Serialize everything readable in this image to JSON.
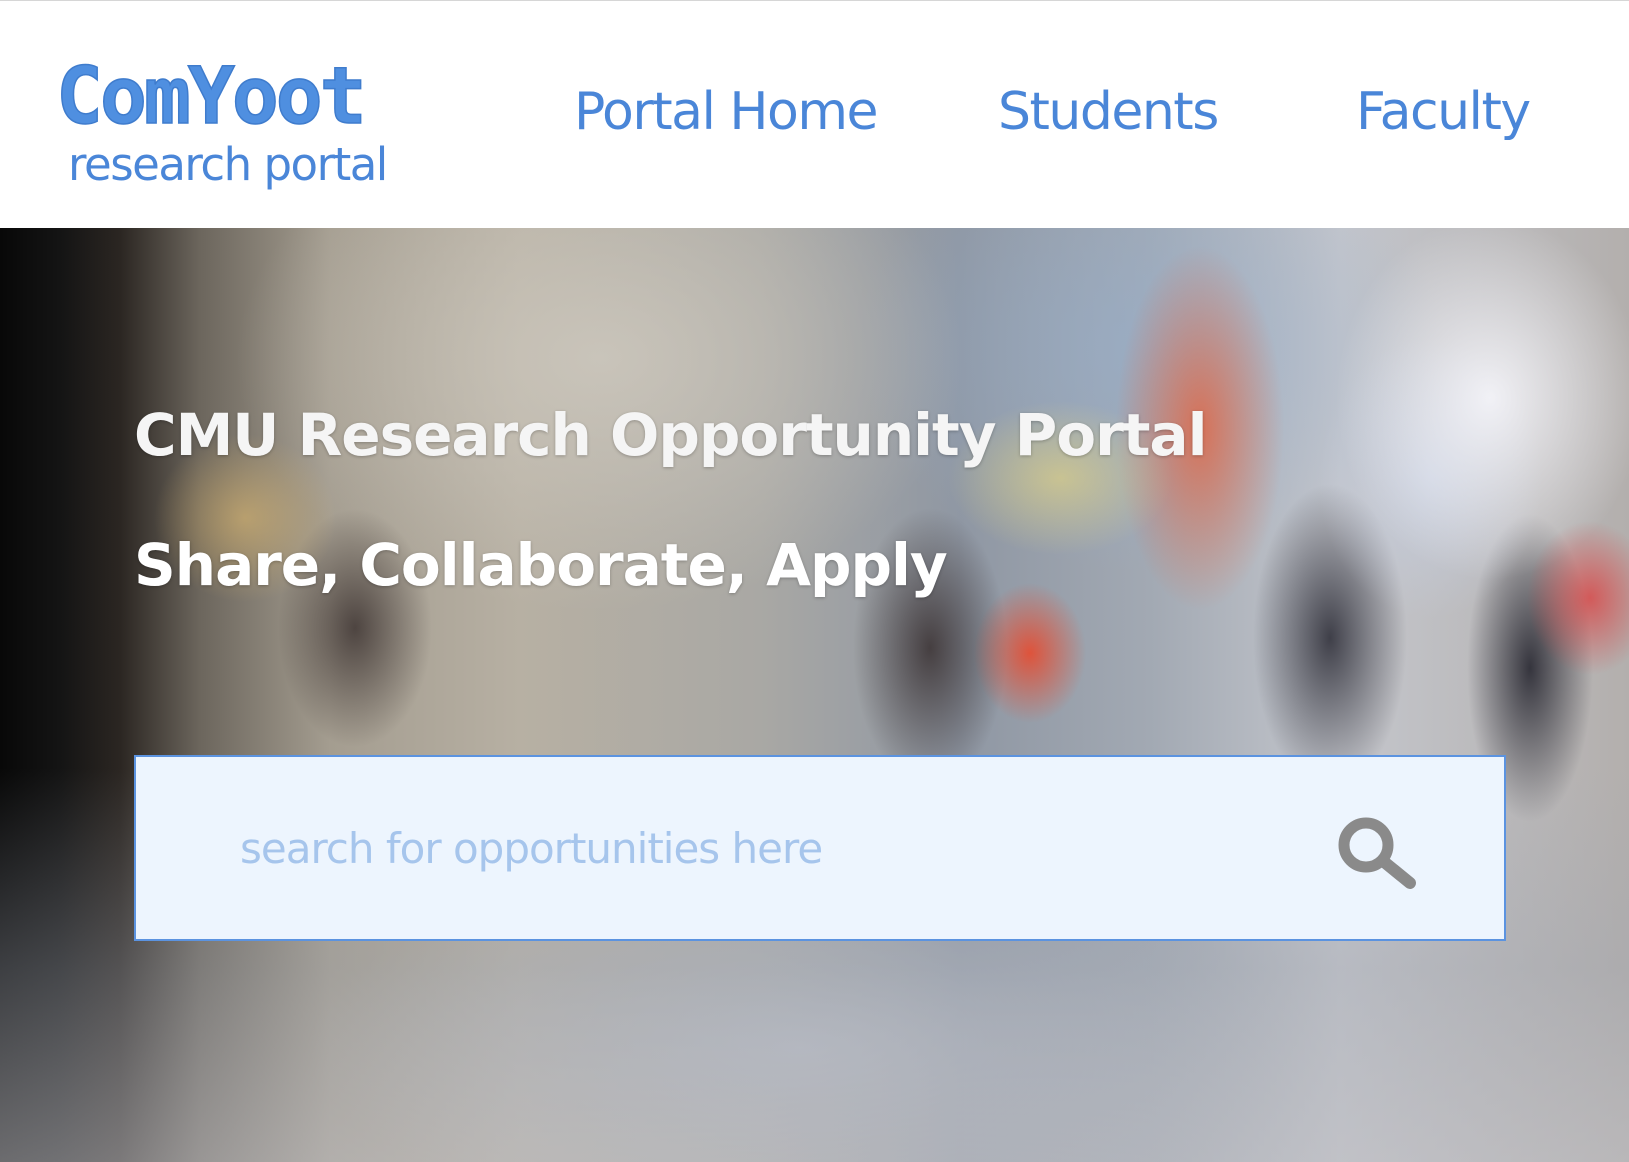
{
  "header": {
    "logo": {
      "wordmark": "ComYoot",
      "tagline": "research portal"
    },
    "nav": {
      "portal_home": "Portal Home",
      "students": "Students",
      "faculty": "Faculty"
    }
  },
  "hero": {
    "title": "CMU Research Opportunity Portal",
    "subtitle": "Share, Collaborate, Apply"
  },
  "search": {
    "placeholder": "search for opportunities here",
    "value": "",
    "icon": "search-icon"
  },
  "colors": {
    "brand_blue": "#4a86d8",
    "search_border": "#5b93e0",
    "search_background": "#edf5fe",
    "placeholder": "#a6c5ec",
    "search_icon": "#8a8a8a",
    "hero_text": "#ffffff"
  }
}
